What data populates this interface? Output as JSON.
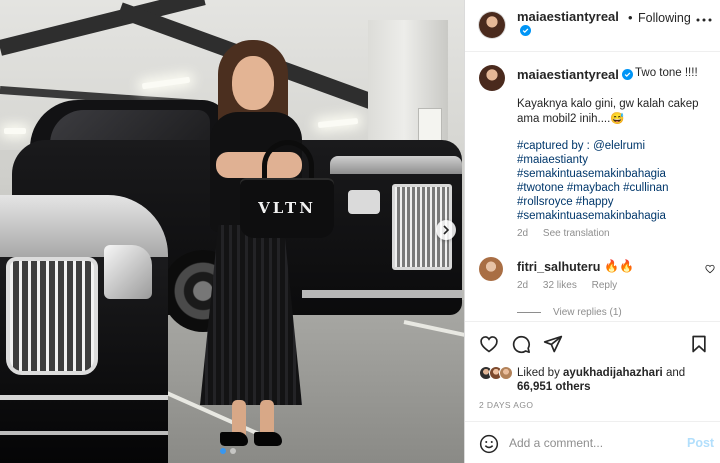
{
  "post": {
    "username": "maiaestiantyreal",
    "follow_label": "Following",
    "separator": "•",
    "photo": {
      "bag_text": "VLTN"
    },
    "caption": {
      "first_line": "Two tone !!!!",
      "body": "Kayaknya kalo gini, gw kalah cakep ama mobil2 inih....😅",
      "credit": "#captured by : @elelrumi",
      "tags": "#maiaestianty #semakintuasemakinbahagia #twotone #maybach #cullinan #rollsroyce #happy #semakintuasemakinbahagia",
      "age": "2d",
      "translation_label": "See translation"
    },
    "comment": {
      "username": "fitri_salhuteru",
      "emoji": "🔥🔥",
      "age": "2d",
      "likes": "32 likes",
      "reply_label": "Reply",
      "view_replies": "View replies (1)"
    },
    "likes": {
      "prefix": "Liked by ",
      "user": "ayukhadijahazhari",
      "middle": " and ",
      "count": "66,951 others"
    },
    "time_ago": "2 DAYS AGO",
    "add_comment": {
      "placeholder": "Add a comment...",
      "post_label": "Post"
    }
  },
  "colors": {
    "accent_blue": "#0095f6",
    "post_disabled": "#b2dffc",
    "hashtag": "#00376b",
    "muted": "#8e8e8e",
    "carousel_dot_active": "#3897f0"
  },
  "icons": {
    "verified": "verified-badge-icon",
    "more": "more-options-icon",
    "like": "heart-icon",
    "comment": "comment-icon",
    "share": "share-icon",
    "save": "bookmark-icon",
    "emoji": "smiley-icon",
    "next": "chevron-right-icon"
  }
}
